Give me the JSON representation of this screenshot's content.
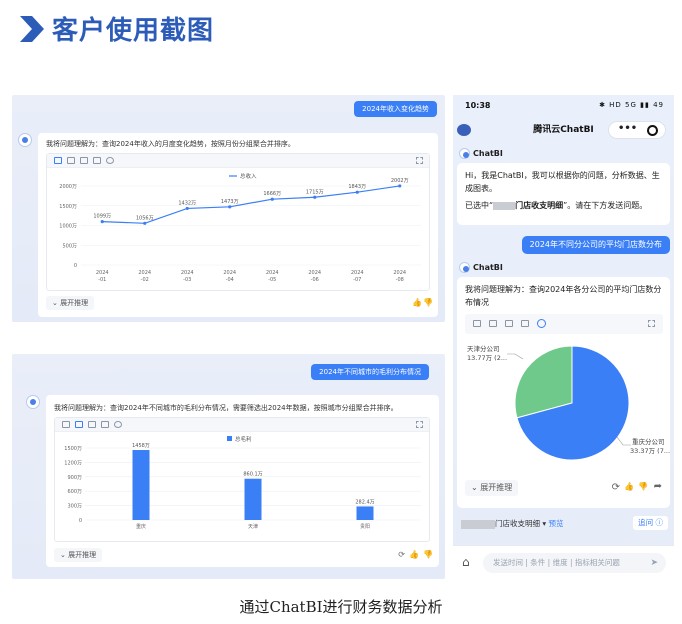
{
  "header": {
    "title": "客户使用截图"
  },
  "caption": "通过ChatBI进行财务数据分析",
  "colors": {
    "accent": "#3a7ff6",
    "brand_title": "#2c5cb8",
    "green_slice": "#6ec98a"
  },
  "panel1": {
    "user_query": "2024年收入变化趋势",
    "bot_answer": "我将问题理解为：查询2024年收入的月度变化趋势，按照月份分组聚合并排序。",
    "expand_label": "展开推理",
    "legend": "总收入",
    "chart_data": {
      "type": "line",
      "categories": [
        "2024-01",
        "2024-02",
        "2024-03",
        "2024-04",
        "2024-05",
        "2024-06",
        "2024-07",
        "2024-08"
      ],
      "series": [
        {
          "name": "总收入",
          "values": [
            1099,
            1056,
            1432,
            1473,
            1666,
            1715,
            1843,
            2002
          ]
        }
      ],
      "data_labels": [
        "1099万",
        "1056万",
        "1432万",
        "1473万",
        "1666万",
        "1715万",
        "1843万",
        "2002万"
      ],
      "y_ticks": [
        "0",
        "500万",
        "1000万",
        "1500万",
        "2000万"
      ],
      "ylim": [
        0,
        2000
      ],
      "grid": true,
      "legend_position": "top"
    }
  },
  "panel2": {
    "user_query": "2024年不同城市的毛利分布情况",
    "bot_answer": "我将问题理解为：查询2024年不同城市的毛利分布情况，需要筛选出2024年数据，按照城市分组聚合并排序。",
    "expand_label": "展开推理",
    "legend": "总毛利",
    "chart_data": {
      "type": "bar",
      "categories": [
        "重庆",
        "天津",
        "贵阳"
      ],
      "series": [
        {
          "name": "总毛利",
          "values": [
            1458,
            860.1,
            282.4
          ]
        }
      ],
      "data_labels": [
        "1458万",
        "860.1万",
        "282.4万"
      ],
      "y_ticks": [
        "0",
        "300万",
        "600万",
        "900万",
        "1200万",
        "1500万"
      ],
      "ylim": [
        0,
        1500
      ],
      "grid": true,
      "legend_position": "top"
    }
  },
  "phone": {
    "time": "10:38",
    "status_icons": "✱ HD 5G ▮▮ 49",
    "title": "腾讯云ChatBI",
    "bot_name": "ChatBI",
    "greeting": "Hi，我是ChatBI，我可以根据你的问题，分析数据、生成图表。",
    "selected_prefix": "已选中“",
    "selected_name": "门店收支明细",
    "selected_suffix": "”。请在下方发送问题。",
    "user_query": "2024年不同分公司的平均门店数分布",
    "bot_answer": "我将问题理解为：查询2024年各分公司的平均门店数分布情况",
    "expand_label": "展开推理",
    "table_chip": "门店收支明细",
    "preview_label": "预览",
    "back_label": "追问",
    "input_placeholder": "发送时间 | 条件 | 维度 | 指标相关问题",
    "chart_data": {
      "type": "pie",
      "categories": [
        "天津分公司",
        "重庆分公司"
      ],
      "values": [
        13.77,
        33.37
      ],
      "labels": [
        "天津分公司",
        "重庆分公司"
      ],
      "value_labels": [
        "13.77万 (2...",
        "33.37万 (7..."
      ]
    }
  }
}
